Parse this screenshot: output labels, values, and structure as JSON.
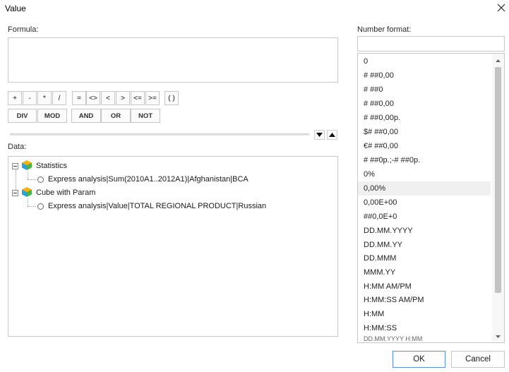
{
  "dialog": {
    "title": "Value",
    "close_icon": "close-icon"
  },
  "formula": {
    "label": "Formula:",
    "value": ""
  },
  "operators": {
    "row1": [
      "+",
      "-",
      "*",
      "/",
      "=",
      "<>",
      "<",
      ">",
      "<=",
      ">=",
      "( )"
    ],
    "row2": [
      "DIV",
      "MOD",
      "AND",
      "OR",
      "NOT"
    ]
  },
  "data": {
    "label": "Data:",
    "tree": [
      {
        "label": "Statistics",
        "icon": "cube-icon",
        "children": [
          "Express analysis|Sum(2010A1..2012A1)|Afghanistan|BCA"
        ]
      },
      {
        "label": "Cube with Param",
        "icon": "cube-icon",
        "children": [
          "Express analysis|Value|TOTAL REGIONAL PRODUCT|Russian"
        ]
      }
    ]
  },
  "number_format": {
    "label": "Number format:",
    "value": "",
    "selected_index": 9,
    "items": [
      "0",
      "# ##0,00",
      "# ##0",
      "# ##0,00",
      "# ##0,00р.",
      "$# ##0,00",
      "€# ##0,00",
      "# ##0р.;-# ##0р.",
      "0%",
      "0,00%",
      "0,00E+00",
      "##0,0E+0",
      "DD.MM.YYYY",
      "DD.MM.YY",
      "DD.MMM",
      "MMM.YY",
      "H:MM AM/PM",
      "H:MM:SS AM/PM",
      "H:MM",
      "H:MM:SS",
      "DD.MM.YYYY H:MM"
    ]
  },
  "buttons": {
    "ok": "OK",
    "cancel": "Cancel"
  },
  "colors": {
    "ok_border": "#5b8fd6",
    "border": "#c8c8c8",
    "selected_bg": "#f0f0f0"
  }
}
